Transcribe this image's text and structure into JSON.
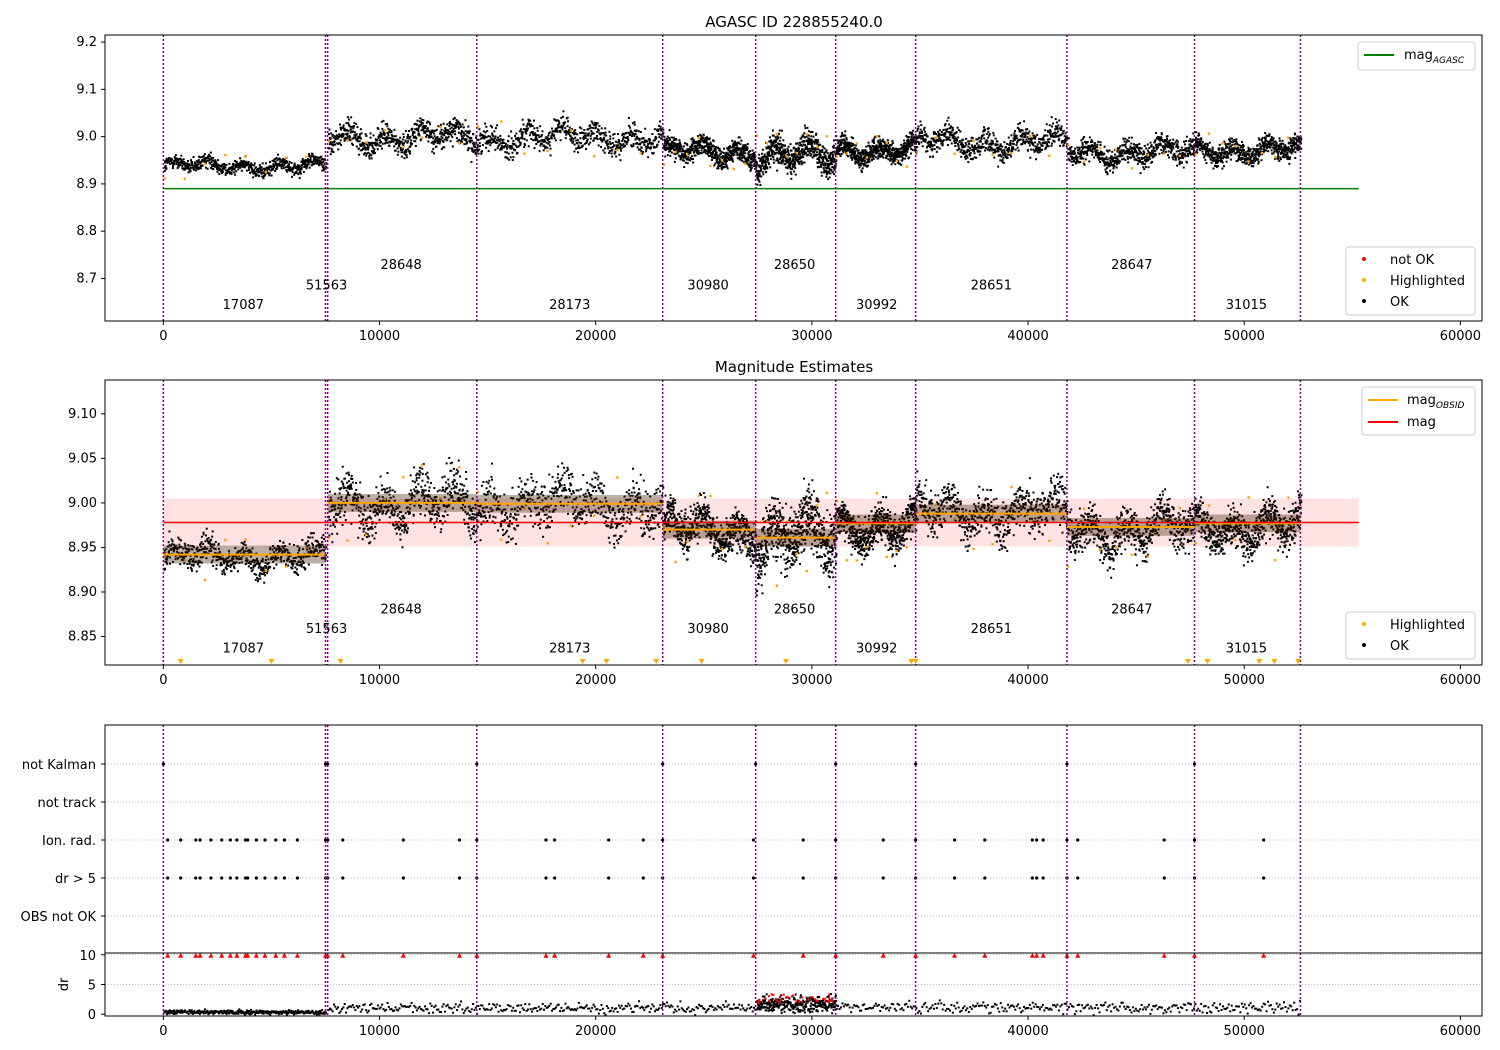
{
  "figure": {
    "title": "AGASC ID 228855240.0"
  },
  "chart_data": [
    {
      "type": "scatter",
      "title": "AGASC ID 228855240.0",
      "xlim": [
        -2700,
        61000
      ],
      "ylim": [
        8.61,
        9.215
      ],
      "xticks": [
        0,
        10000,
        20000,
        30000,
        40000,
        50000,
        60000
      ],
      "yticks": [
        8.7,
        8.8,
        8.9,
        9.0,
        9.1,
        9.2
      ],
      "ytick_labels": [
        "8.7",
        "8.8",
        "8.9",
        "9.0",
        "9.1",
        "9.2"
      ],
      "vlines": [
        0,
        7500,
        7600,
        14500,
        23100,
        27400,
        31100,
        34800,
        41800,
        47700,
        52600
      ],
      "obsids": [
        {
          "label": "17087",
          "x": 3700,
          "y": 8.635
        },
        {
          "label": "51563",
          "x": 7550,
          "y": 8.677
        },
        {
          "label": "28648",
          "x": 11000,
          "y": 8.72
        },
        {
          "label": "28173",
          "x": 18800,
          "y": 8.635
        },
        {
          "label": "30980",
          "x": 25200,
          "y": 8.677
        },
        {
          "label": "28650",
          "x": 29200,
          "y": 8.72
        },
        {
          "label": "30992",
          "x": 33000,
          "y": 8.635
        },
        {
          "label": "28651",
          "x": 38300,
          "y": 8.677
        },
        {
          "label": "28647",
          "x": 44800,
          "y": 8.72
        },
        {
          "label": "31015",
          "x": 50100,
          "y": 8.635
        }
      ],
      "segments": [
        {
          "x0": 0,
          "x1": 7500,
          "center": 8.94,
          "spread": 0.014
        },
        {
          "x0": 7600,
          "x1": 14500,
          "center": 9.0,
          "spread": 0.024
        },
        {
          "x0": 14500,
          "x1": 23100,
          "center": 9.0,
          "spread": 0.024
        },
        {
          "x0": 23100,
          "x1": 27400,
          "center": 8.97,
          "spread": 0.02
        },
        {
          "x0": 27400,
          "x1": 31100,
          "center": 8.96,
          "spread": 0.03
        },
        {
          "x0": 31100,
          "x1": 34800,
          "center": 8.975,
          "spread": 0.02
        },
        {
          "x0": 34800,
          "x1": 41800,
          "center": 8.99,
          "spread": 0.022
        },
        {
          "x0": 41800,
          "x1": 47700,
          "center": 8.97,
          "spread": 0.022
        },
        {
          "x0": 47700,
          "x1": 52600,
          "center": 8.975,
          "spread": 0.02
        }
      ],
      "hlines": [
        {
          "name": "mag_AGASC",
          "y": 8.89,
          "x0": 0,
          "x1": 55300,
          "color": "#008000"
        }
      ],
      "legend_upper": {
        "label": "mag",
        "sub": "AGASC",
        "color": "#008000"
      },
      "legend_lower": [
        {
          "label": "not OK",
          "color": "#ff0000"
        },
        {
          "label": "Highlighted",
          "color": "#ffa500"
        },
        {
          "label": "OK",
          "color": "#000000"
        }
      ]
    },
    {
      "type": "scatter",
      "title": "Magnitude Estimates",
      "xlim": [
        -2700,
        61000
      ],
      "ylim": [
        8.818,
        9.138
      ],
      "xticks": [
        0,
        10000,
        20000,
        30000,
        40000,
        50000,
        60000
      ],
      "yticks": [
        8.85,
        8.9,
        8.95,
        9.0,
        9.05,
        9.1
      ],
      "ytick_labels": [
        "8.85",
        "8.90",
        "8.95",
        "9.00",
        "9.05",
        "9.10"
      ],
      "vlines": [
        0,
        7500,
        7600,
        14500,
        23100,
        27400,
        31100,
        34800,
        41800,
        47700,
        52600
      ],
      "obsids": [
        {
          "label": "17087",
          "x": 3700,
          "y": 8.832
        },
        {
          "label": "51563",
          "x": 7550,
          "y": 8.854
        },
        {
          "label": "28648",
          "x": 11000,
          "y": 8.876
        },
        {
          "label": "28173",
          "x": 18800,
          "y": 8.832
        },
        {
          "label": "30980",
          "x": 25200,
          "y": 8.854
        },
        {
          "label": "28650",
          "x": 29200,
          "y": 8.876
        },
        {
          "label": "30992",
          "x": 33000,
          "y": 8.832
        },
        {
          "label": "28651",
          "x": 38300,
          "y": 8.854
        },
        {
          "label": "28647",
          "x": 44800,
          "y": 8.876
        },
        {
          "label": "31015",
          "x": 50100,
          "y": 8.832
        }
      ],
      "obsid_mags": [
        {
          "x0": 0,
          "x1": 7500,
          "mag": 8.942
        },
        {
          "x0": 7600,
          "x1": 14500,
          "mag": 9.0
        },
        {
          "x0": 14500,
          "x1": 23100,
          "mag": 8.999
        },
        {
          "x0": 23100,
          "x1": 27400,
          "mag": 8.97
        },
        {
          "x0": 27400,
          "x1": 31100,
          "mag": 8.961
        },
        {
          "x0": 31100,
          "x1": 34800,
          "mag": 8.977
        },
        {
          "x0": 34800,
          "x1": 41800,
          "mag": 8.988
        },
        {
          "x0": 41800,
          "x1": 47700,
          "mag": 8.973
        },
        {
          "x0": 47700,
          "x1": 52600,
          "mag": 8.977
        }
      ],
      "mag": {
        "y": 8.978,
        "band": [
          8.951,
          9.005
        ],
        "x0": 0,
        "x1": 55300,
        "color": "#ff0000"
      },
      "legend_upper": [
        {
          "label": "mag",
          "sub": "OBSID",
          "color": "#ffa500"
        },
        {
          "label": "mag",
          "sub": "",
          "color": "#ff0000"
        }
      ],
      "legend_lower": [
        {
          "label": "Highlighted",
          "color": "#ffa500"
        },
        {
          "label": "OK",
          "color": "#000000"
        }
      ]
    },
    {
      "type": "scatter",
      "xlim": [
        -2700,
        61000
      ],
      "flag_rows": [
        "not Kalman",
        "not track",
        "Ion. rad.",
        "dr > 5",
        "OBS not OK"
      ],
      "flag_events": {
        "not Kalman": [
          0,
          7500,
          7600,
          14500,
          23100,
          27400,
          31100,
          34800,
          41800,
          47700
        ],
        "not track": [],
        "Ion. rad.": [
          200,
          800,
          1500,
          1700,
          2200,
          2700,
          3100,
          3400,
          3800,
          3900,
          4300,
          4700,
          5200,
          5600,
          6200,
          7500,
          7600,
          8300,
          11100,
          13700,
          14500,
          17700,
          18100,
          20600,
          22200,
          23100,
          27300,
          29600,
          31100,
          33300,
          34800,
          36600,
          38000,
          40200,
          40400,
          40700,
          41800,
          42300,
          46300,
          47700,
          50900
        ],
        "dr > 5": [
          200,
          800,
          1500,
          1700,
          2200,
          2700,
          3100,
          3400,
          3800,
          3900,
          4300,
          4700,
          5200,
          5600,
          6200,
          7500,
          7600,
          8300,
          11100,
          13700,
          14500,
          17700,
          18100,
          20600,
          22200,
          23100,
          27300,
          29600,
          31100,
          33300,
          34800,
          36600,
          38000,
          40200,
          40400,
          40700,
          41800,
          42300,
          46300,
          47700,
          50900
        ],
        "OBS not OK": []
      },
      "vlines": [
        0,
        7500,
        7600,
        14500,
        23100,
        27400,
        31100,
        34800,
        41800,
        47700,
        52600
      ]
    },
    {
      "type": "scatter",
      "xlim": [
        -2700,
        61000
      ],
      "ylim": [
        -0.3,
        10.3
      ],
      "ylabel": "dr",
      "yticks": [
        0,
        5,
        10
      ],
      "ytick_labels": [
        "0",
        "5",
        "10"
      ],
      "xticks": [
        0,
        10000,
        20000,
        30000,
        40000,
        50000,
        60000
      ],
      "xtick_labels": [
        "0",
        "10000",
        "20000",
        "30000",
        "40000",
        "50000",
        "60000"
      ],
      "vlines": [
        0,
        7500,
        7600,
        14500,
        23100,
        27400,
        31100,
        34800,
        41800,
        47700,
        52600
      ],
      "dr_segments": [
        {
          "x0": 0,
          "x1": 7500,
          "level": 0.5
        },
        {
          "x0": 7600,
          "x1": 27400,
          "level": 1.2
        },
        {
          "x0": 27400,
          "x1": 31100,
          "level": 1.8
        },
        {
          "x0": 31100,
          "x1": 52600,
          "level": 1.3
        }
      ],
      "dr_capped": [
        200,
        800,
        1500,
        1700,
        2200,
        2700,
        3100,
        3400,
        3800,
        3900,
        4300,
        4700,
        5200,
        5600,
        6200,
        7500,
        7600,
        8300,
        11100,
        13700,
        14500,
        17700,
        18100,
        20600,
        22200,
        23100,
        27300,
        29600,
        31100,
        33300,
        34800,
        36600,
        38000,
        40200,
        40400,
        40700,
        41800,
        42300,
        46300,
        47700,
        50900
      ]
    }
  ],
  "colors": {
    "ok": "#000000",
    "highlighted": "#ffa500",
    "not_ok": "#ff0000",
    "obsid_line": "#800080",
    "agasc": "#008000",
    "mag": "#ff0000",
    "band": "#ffc0c0"
  }
}
